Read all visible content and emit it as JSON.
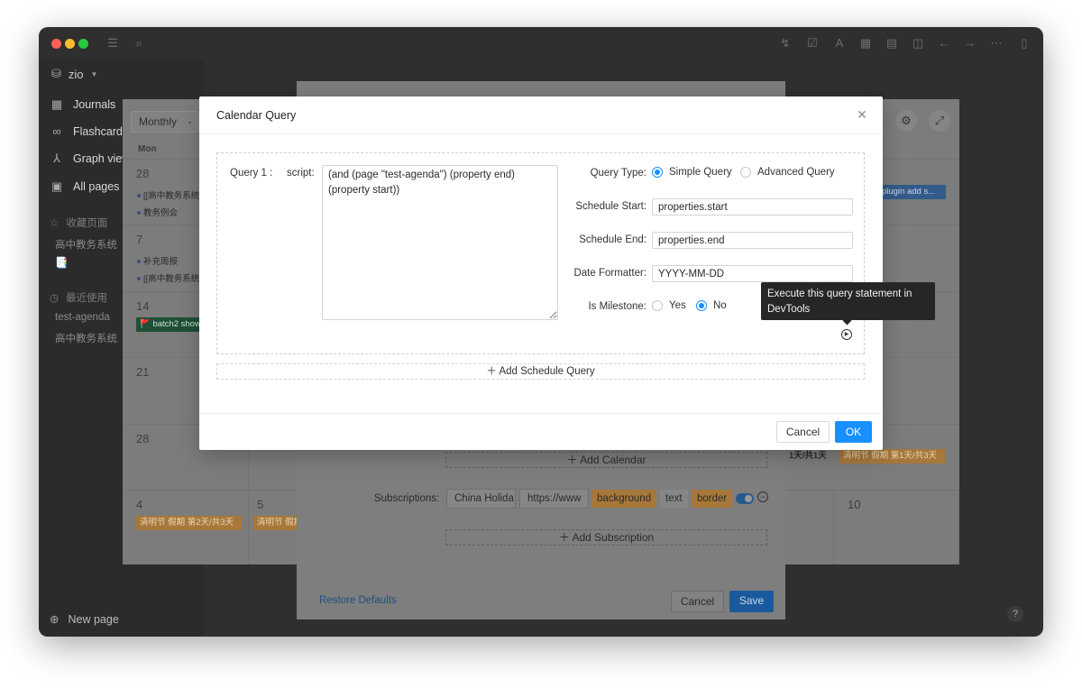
{
  "sidebar": {
    "workspace": "zio",
    "nav": [
      {
        "label": "Journals",
        "icon": "calendar-icon"
      },
      {
        "label": "Flashcards",
        "icon": "infinity-icon"
      },
      {
        "label": "Graph view",
        "icon": "graph-icon"
      },
      {
        "label": "All pages",
        "icon": "pages-icon"
      }
    ],
    "favorites_title": "收藏页面",
    "favorites": [
      "高中教务系统",
      "📑"
    ],
    "recent_title": "最近使用",
    "recent": [
      "test-agenda",
      "高中教务系统"
    ],
    "new_page": "New page",
    "help": "?"
  },
  "calendar": {
    "view_select": "Monthly",
    "weekday": "Mon",
    "weeks": [
      {
        "day": "28",
        "events": [
          "[[高中教务系统",
          "教务例会"
        ]
      },
      {
        "day": "7",
        "events": [
          "补充周报",
          "[[高中教务系统"
        ]
      },
      {
        "day": "14",
        "events": []
      },
      {
        "day": "21",
        "events": []
      },
      {
        "day": "28",
        "events": []
      }
    ],
    "last_week_days": [
      "4",
      "5",
      "10"
    ],
    "bar_batch": "🚩 batch2 show",
    "bar_plugin": "plugin add s...",
    "bar_holiday_1": "清明节 假期 第2天/共3天",
    "bar_holiday_2": "清明节 假期",
    "bar_holiday_3": "清明节 假期 第1天/共3天",
    "bar_holiday_4": "1天/共1天",
    "colors": {
      "holiday": "#c0873a",
      "batch": "#1f4f35",
      "plugin": "#335b8a"
    }
  },
  "settings": {
    "add_calendar": "Add Calendar",
    "subscriptions_label": "Subscriptions:",
    "sub_name": "China Holida",
    "sub_url": "https://www",
    "tag_background": "background",
    "tag_text": "text",
    "tag_border": "border",
    "add_subscription": "Add Subscription",
    "restore_defaults": "Restore Defaults",
    "cancel": "Cancel",
    "save": "Save"
  },
  "dialog": {
    "title": "Calendar Query",
    "query_label": "Query 1 :",
    "script_label": "script:",
    "script_value": "(and (page \"test-agenda\") (property end) (property start))",
    "query_type_label": "Query Type:",
    "query_type_options": [
      "Simple Query",
      "Advanced Query"
    ],
    "query_type_selected": "Simple Query",
    "schedule_start_label": "Schedule Start:",
    "schedule_start_value": "properties.start",
    "schedule_end_label": "Schedule End:",
    "schedule_end_value": "properties.end",
    "date_formatter_label": "Date Formatter:",
    "date_formatter_value": "YYYY-MM-DD",
    "milestone_label": "Is Milestone:",
    "milestone_options": [
      "Yes",
      "No"
    ],
    "milestone_selected": "No",
    "tooltip": "Execute this query statement in DevTools",
    "add_schedule_query": "Add Schedule Query",
    "cancel": "Cancel",
    "ok": "OK"
  }
}
